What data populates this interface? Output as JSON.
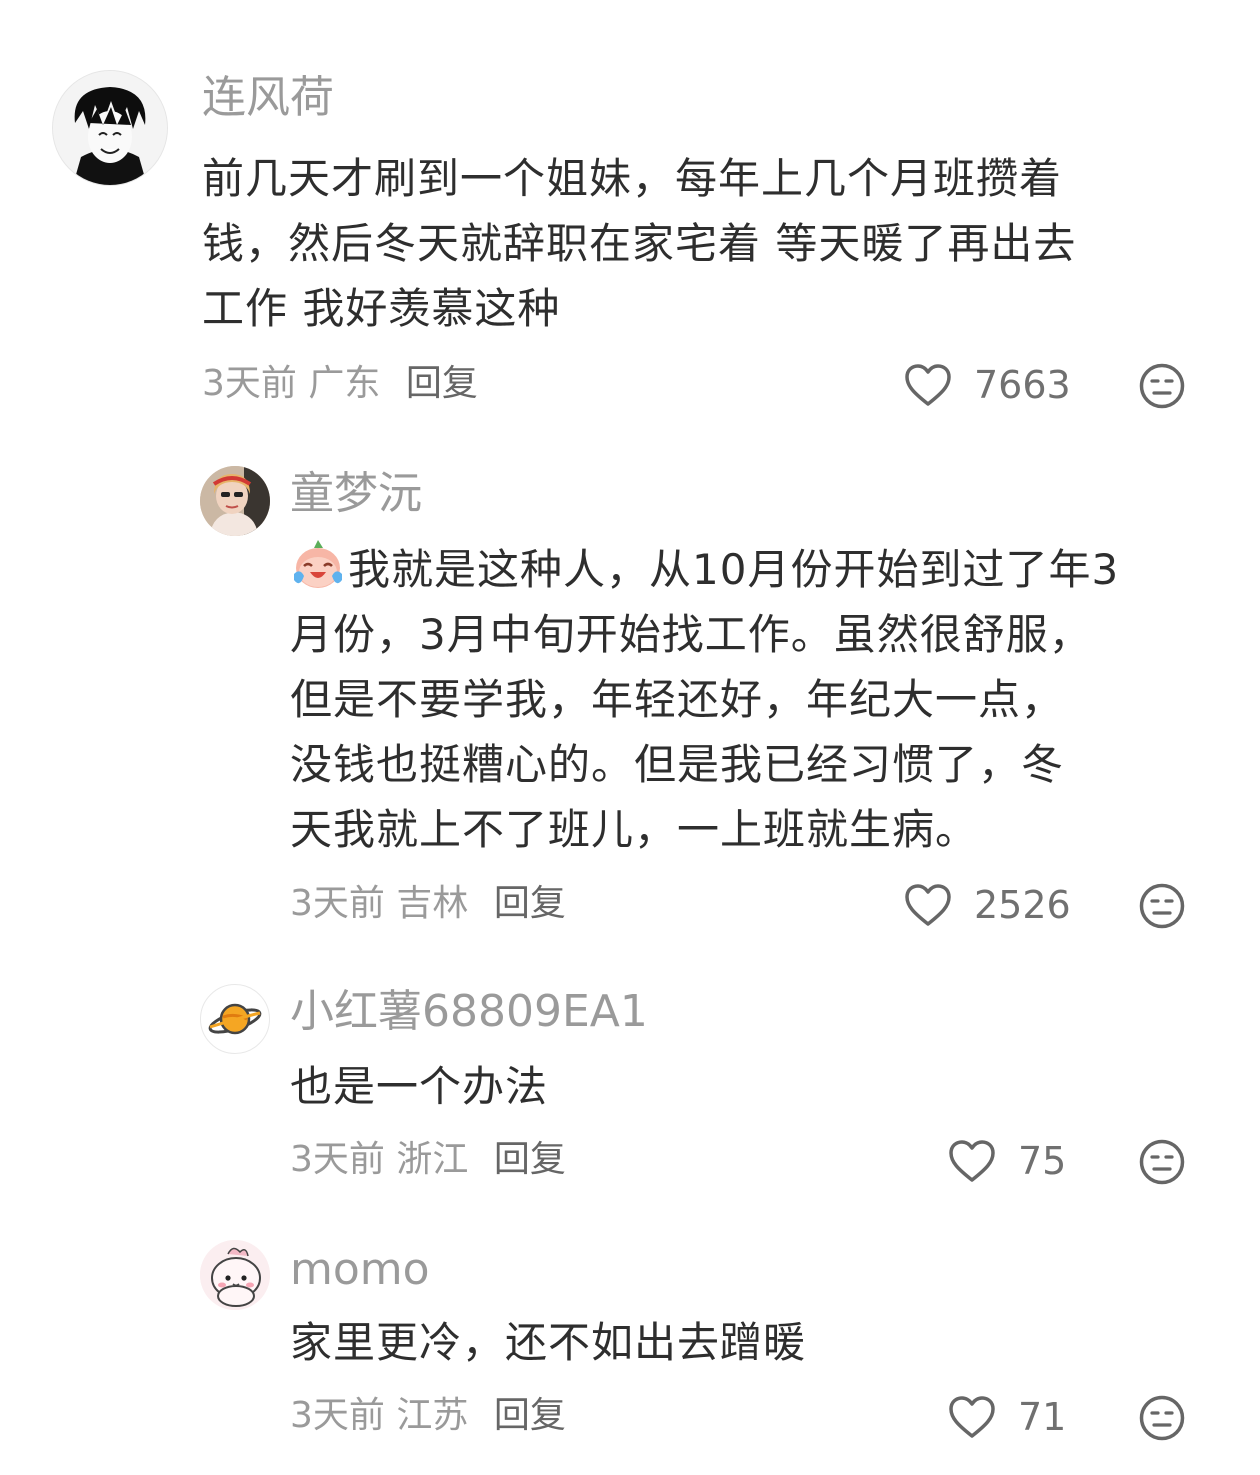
{
  "comments": [
    {
      "username": "连风荷",
      "content": [
        "前几天才刷到一个姐妹，每年上几个月班攒着",
        "钱，然后冬天就辞职在家宅着 等天暖了再出去",
        "工作  我好羡慕这种"
      ],
      "time": "3天前",
      "location": "广东",
      "reply_label": "回复",
      "likes": "7663"
    },
    {
      "username": "童梦沅",
      "content_first": "我就是这种人，从10月份开始到过了年3",
      "content": [
        "月份，3月中旬开始找工作。虽然很舒服，",
        "但是不要学我，年轻还好，年纪大一点，",
        "没钱也挺糟心的。但是我已经习惯了，冬",
        "天我就上不了班儿，一上班就生病。"
      ],
      "time": "3天前",
      "location": "吉林",
      "reply_label": "回复",
      "likes": "2526"
    },
    {
      "username": "小红薯68809EA1",
      "content": [
        "也是一个办法"
      ],
      "time": "3天前",
      "location": "浙江",
      "reply_label": "回复",
      "likes": "75"
    },
    {
      "username": "momo",
      "content": [
        "家里更冷，还不如出去蹭暖"
      ],
      "time": "3天前",
      "location": "江苏",
      "reply_label": "回复",
      "likes": "71"
    }
  ],
  "icons": {
    "like": "heart-outline-icon",
    "reaction": "neutral-face-icon",
    "inline_emoji": "crying-laughing-emoji"
  },
  "colors": {
    "username": "#9a9a9a",
    "content": "#2e2e2e",
    "meta": "#9a9a9a"
  }
}
